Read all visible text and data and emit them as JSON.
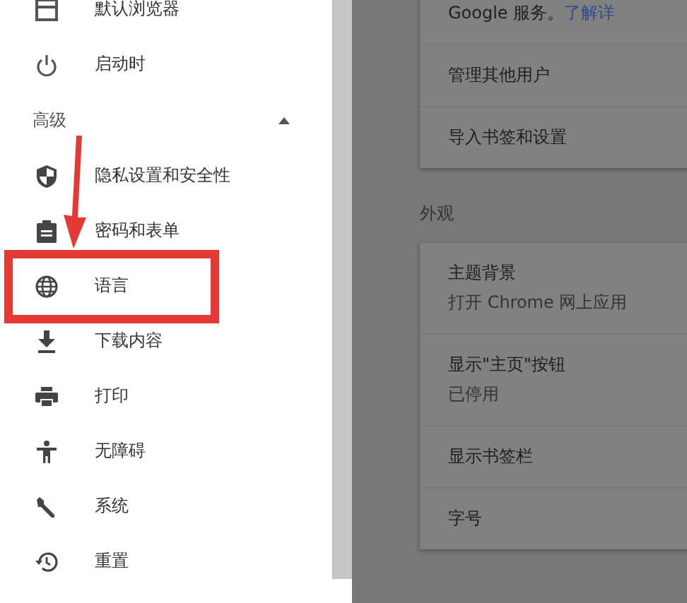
{
  "sidebar": {
    "items": [
      {
        "label": "默认浏览器"
      },
      {
        "label": "启动时"
      },
      {
        "label": "高级",
        "kind": "section",
        "expanded": true
      },
      {
        "label": "隐私设置和安全性"
      },
      {
        "label": "密码和表单"
      },
      {
        "label": "语言"
      },
      {
        "label": "下载内容"
      },
      {
        "label": "打印"
      },
      {
        "label": "无障碍"
      },
      {
        "label": "系统"
      },
      {
        "label": "重置"
      }
    ]
  },
  "main": {
    "people_card": {
      "rows": [
        {
          "text": "Google 服务。",
          "link": "了解详"
        },
        {
          "text": "管理其他用户"
        },
        {
          "text": "导入书签和设置"
        }
      ]
    },
    "appearance": {
      "heading": "外观",
      "rows": [
        {
          "title": "主题背景",
          "subtitle": "打开 Chrome 网上应用"
        },
        {
          "title": "显示\"主页\"按钮",
          "subtitle": "已停用"
        },
        {
          "title": "显示书签栏"
        },
        {
          "title": "字号"
        }
      ]
    }
  }
}
